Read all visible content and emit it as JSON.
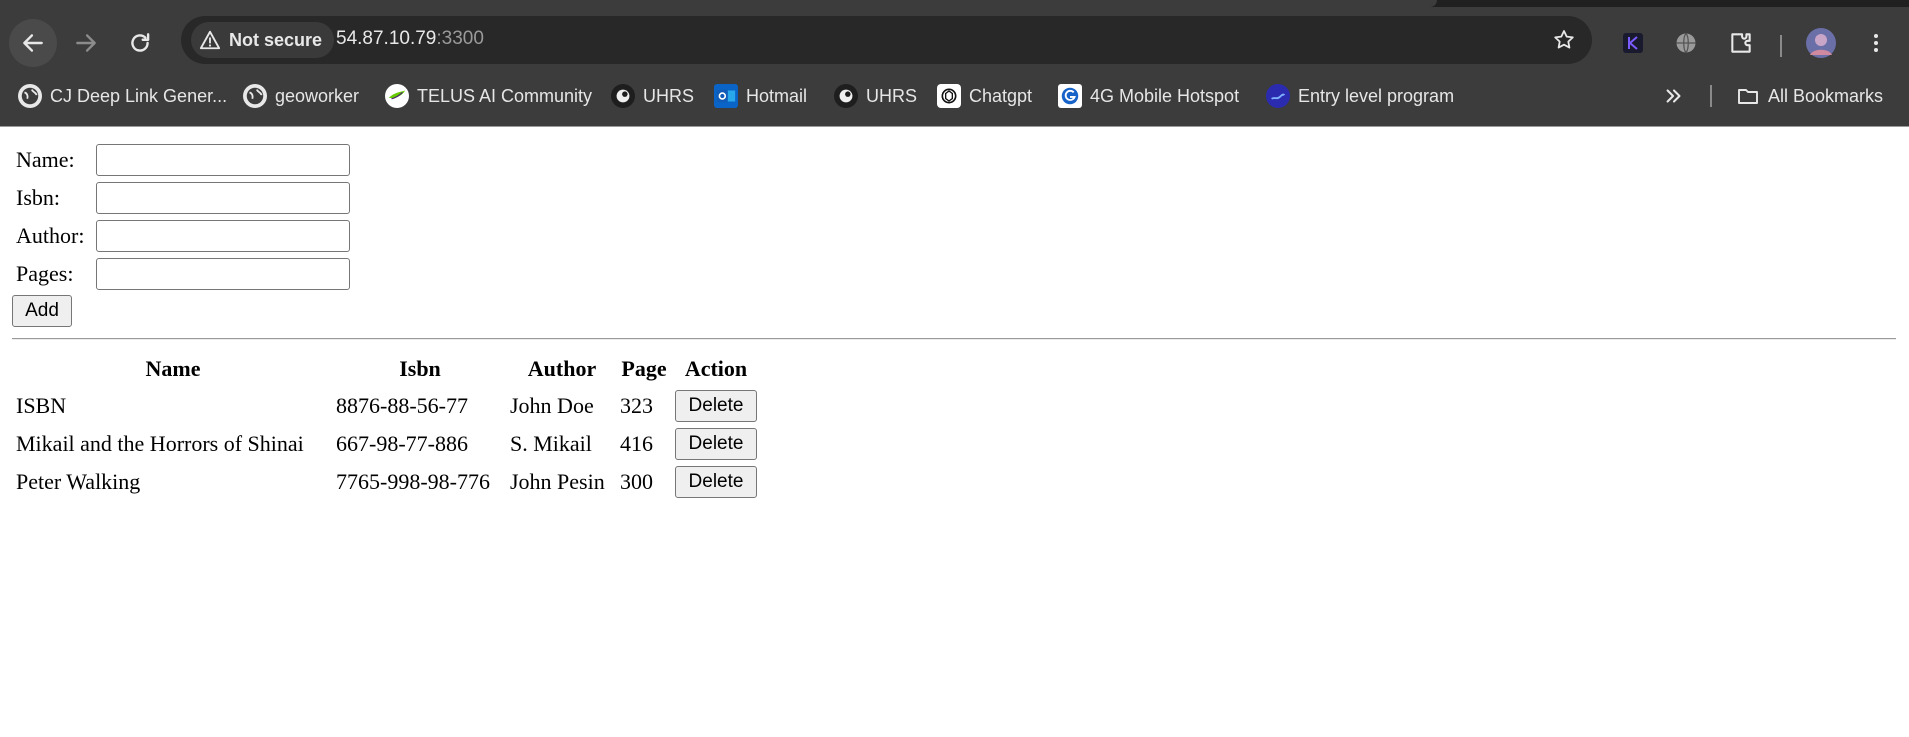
{
  "browser": {
    "security_label": "Not secure",
    "url_host": "54.87.10.79",
    "url_port": ":3300",
    "bookmarks": [
      {
        "label": "CJ Deep Link Gener...",
        "icon": "globe-icon"
      },
      {
        "label": "geoworker",
        "icon": "globe-icon"
      },
      {
        "label": "TELUS AI Community",
        "icon": "telus-leaf-icon"
      },
      {
        "label": "UHRS",
        "icon": "uhrs-icon"
      },
      {
        "label": "Hotmail",
        "icon": "outlook-icon"
      },
      {
        "label": "UHRS",
        "icon": "uhrs-icon"
      },
      {
        "label": "Chatgpt",
        "icon": "chatgpt-icon"
      },
      {
        "label": "4G Mobile Hotspot",
        "icon": "hotspot-icon"
      },
      {
        "label": "Entry level program",
        "icon": "entry-program-icon"
      }
    ],
    "all_bookmarks_label": "All Bookmarks"
  },
  "form": {
    "name_label": "Name:",
    "isbn_label": "Isbn:",
    "author_label": "Author:",
    "pages_label": "Pages:",
    "name_value": "",
    "isbn_value": "",
    "author_value": "",
    "pages_value": "",
    "add_label": "Add"
  },
  "table": {
    "headers": [
      "Name",
      "Isbn",
      "Author",
      "Page",
      "Action"
    ],
    "rows": [
      {
        "name": "ISBN",
        "isbn": "8876-88-56-77",
        "author": "John Doe",
        "page": "323",
        "action": "Delete"
      },
      {
        "name": "Mikail and the Horrors of Shinai",
        "isbn": "667-98-77-886",
        "author": "S. Mikail",
        "page": "416",
        "action": "Delete"
      },
      {
        "name": "Peter Walking",
        "isbn": "7765-998-98-776",
        "author": "John Pesin",
        "page": "300",
        "action": "Delete"
      }
    ]
  },
  "colors": {
    "chrome_bg": "#3c3c3c",
    "omnibox_bg": "#282828",
    "page_bg": "#ffffff",
    "button_bg": "#efefef"
  }
}
